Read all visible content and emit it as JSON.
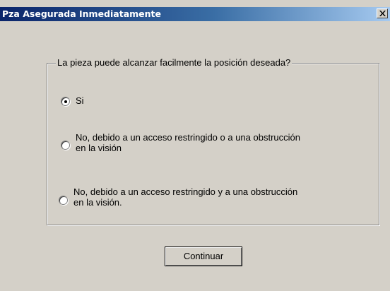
{
  "window": {
    "title": "Pza Asegurada Inmediatamente",
    "close_icon": "close-icon",
    "colors": {
      "titlebar_start": "#0a246a",
      "titlebar_end": "#a6caf0",
      "face": "#d4d0c8"
    }
  },
  "question": {
    "legend": "La pieza puede alcanzar facilmente la posición deseada?",
    "selected_option": "si",
    "options": [
      {
        "id": "si",
        "lines": [
          "Si"
        ],
        "checked": true
      },
      {
        "id": "or",
        "lines": [
          "No, debido a un acceso restringido o a una obstrucción",
          "en la visión"
        ],
        "checked": false
      },
      {
        "id": "and",
        "lines": [
          "No, debido a un acceso restringido y a una obstrucción",
          "en la visión."
        ],
        "checked": false
      }
    ]
  },
  "actions": {
    "continue_label": "Continuar"
  }
}
